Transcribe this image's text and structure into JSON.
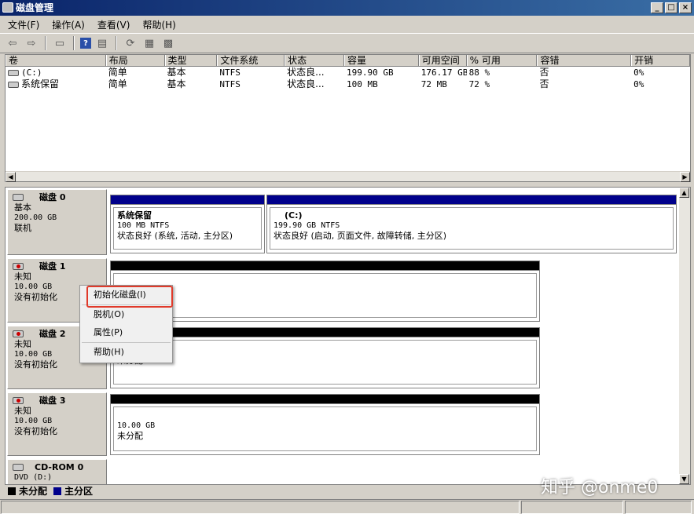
{
  "window": {
    "title": "磁盘管理",
    "btn_min": "_",
    "btn_max": "□",
    "btn_close": "×"
  },
  "menu": [
    "文件(F)",
    "操作(A)",
    "查看(V)",
    "帮助(H)"
  ],
  "toolbar_icons": [
    "back-icon",
    "forward-icon",
    "list-view-icon",
    "help-icon",
    "properties-view-icon",
    "refresh-icon",
    "properties-icon",
    "rescan-icon"
  ],
  "list": {
    "headers": [
      "卷",
      "布局",
      "类型",
      "文件系统",
      "状态",
      "容量",
      "可用空间",
      "% 可用",
      "容错",
      "开销"
    ],
    "rows": [
      [
        "(C:)",
        "简单",
        "基本",
        "NTFS",
        "状态良...",
        "199.90 GB",
        "176.17 GB",
        "88 %",
        "否",
        "0%"
      ],
      [
        "系统保留",
        "简单",
        "基本",
        "NTFS",
        "状态良...",
        "100 MB",
        "72 MB",
        "72 %",
        "否",
        "0%"
      ]
    ]
  },
  "disks": [
    {
      "name": "磁盘 0",
      "type": "基本",
      "size": "200.00 GB",
      "status": "联机"
    },
    {
      "name": "磁盘 1",
      "type": "未知",
      "size": "10.00 GB",
      "status": "没有初始化"
    },
    {
      "name": "磁盘 2",
      "type": "未知",
      "size": "10.00 GB",
      "status": "没有初始化"
    },
    {
      "name": "磁盘 3",
      "type": "未知",
      "size": "10.00 GB",
      "status": "没有初始化"
    },
    {
      "name": "CD-ROM 0",
      "type": "DVD (D:)"
    }
  ],
  "partitions": {
    "p_sys": {
      "title": "系统保留",
      "info": "100 MB NTFS",
      "status": "状态良好 (系统, 活动, 主分区)"
    },
    "p_c": {
      "title": "(C:)",
      "info": "199.90 GB NTFS",
      "status": "状态良好 (启动, 页面文件, 故障转储, 主分区)"
    },
    "p_d2": {
      "status": "未分配"
    },
    "p_d3": {
      "size": "10.00 GB",
      "status": "未分配"
    }
  },
  "legend": {
    "unallocated": "未分配",
    "primary": "主分区"
  },
  "context_menu": [
    "初始化磁盘(I)",
    "脱机(O)",
    "属性(P)",
    "帮助(H)"
  ],
  "watermark": "知乎 @onme0",
  "colors": {
    "primary": "#00008b",
    "unallocated": "#000000",
    "highlight": "#e03a2a",
    "title": "#0a246a"
  }
}
